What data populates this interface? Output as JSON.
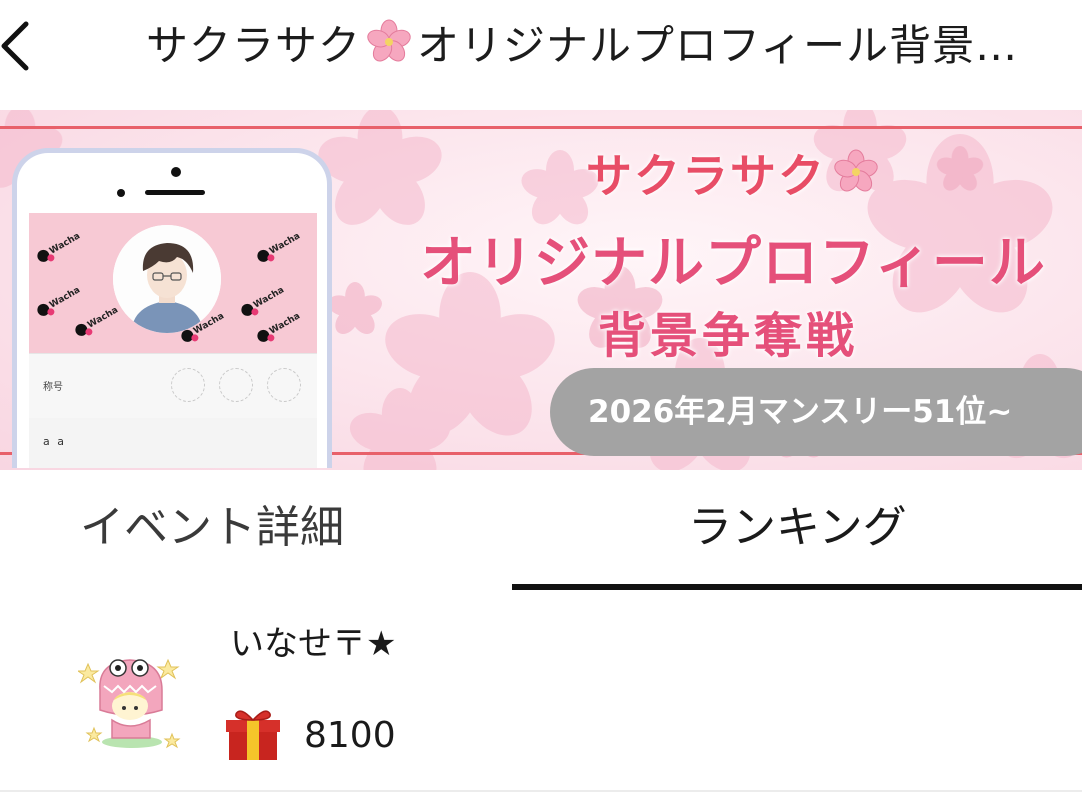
{
  "header": {
    "title_part1": "サクラサク",
    "title_part2": "オリジナルプロフィール背景…"
  },
  "banner": {
    "heading": "サクラサク",
    "title_line1": "オリジナルプロフィール",
    "title_line2": "背景争奪戦",
    "pill_text": "2026年2月マンスリー51位~",
    "phone_mockup": {
      "watermark": "Wacha",
      "title_label": "称号",
      "profile_name": "a a"
    },
    "colors": {
      "accent_pink": "#e5507a",
      "frame_red": "#e8606a",
      "pill_gray": "#a3a3a3"
    }
  },
  "tabs": [
    {
      "label": "イベント詳細",
      "selected": false
    },
    {
      "label": "ランキング",
      "selected": true
    }
  ],
  "ranking": [
    {
      "name": "いなせ〒★",
      "gift_count": "8100",
      "gift_icon": "gift-icon"
    }
  ]
}
